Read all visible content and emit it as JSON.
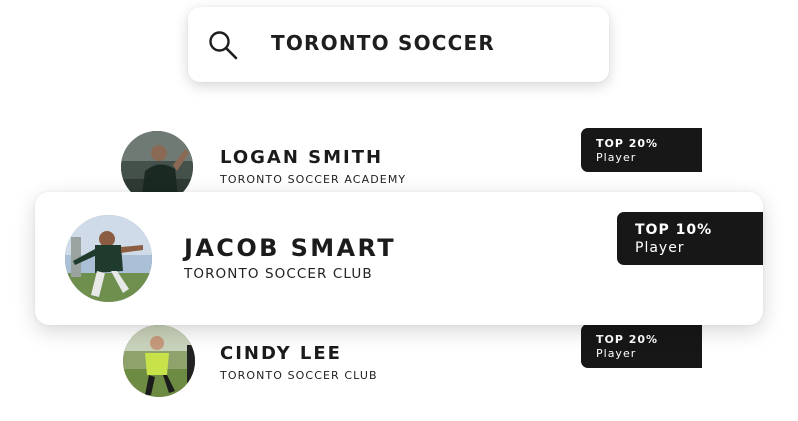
{
  "search": {
    "query": "TORONTO SOCCER",
    "icon": "search-icon"
  },
  "players": [
    {
      "name": "LOGAN SMITH",
      "club": "TORONTO SOCCER ACADEMY",
      "rank": "TOP 20%",
      "rank_label": "Player",
      "icon": "player-avatar"
    },
    {
      "name": "JACOB SMART",
      "club": "TORONTO SOCCER CLUB",
      "rank": "TOP 10%",
      "rank_label": "Player",
      "icon": "player-avatar"
    },
    {
      "name": "CINDY LEE",
      "club": "TORONTO SOCCER CLUB",
      "rank": "TOP 20%",
      "rank_label": "Player",
      "icon": "player-avatar"
    }
  ],
  "colors": {
    "badge": "#171717",
    "text": "#1b1b1b",
    "background": "#ffffff"
  }
}
